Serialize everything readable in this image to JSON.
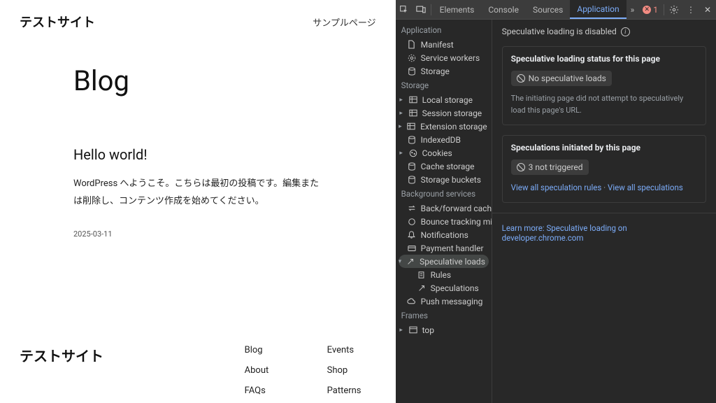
{
  "site": {
    "title": "テストサイト",
    "nav": "サンプルページ",
    "page_heading": "Blog",
    "post": {
      "title": "Hello world!",
      "body": "WordPress へようこそ。こちらは最初の投稿です。編集または削除し、コンテンツ作成を始めてください。",
      "date": "2025-03-11"
    },
    "footer_title": "テストサイト",
    "footer_cols": {
      "col1": {
        "a": "Blog",
        "b": "About",
        "c": "FAQs"
      },
      "col2": {
        "a": "Events",
        "b": "Shop",
        "c": "Patterns"
      }
    }
  },
  "devtools": {
    "tabs": {
      "elements": "Elements",
      "console": "Console",
      "sources": "Sources",
      "application": "Application",
      "more": "»"
    },
    "errors": "1",
    "side": {
      "application": "Application",
      "manifest": "Manifest",
      "service_workers": "Service workers",
      "storage_link": "Storage",
      "storage": "Storage",
      "local_storage": "Local storage",
      "session_storage": "Session storage",
      "extension_storage": "Extension storage",
      "indexeddb": "IndexedDB",
      "cookies": "Cookies",
      "cache_storage": "Cache storage",
      "storage_buckets": "Storage buckets",
      "bg_services": "Background services",
      "bfcache": "Back/forward cache",
      "bounce": "Bounce tracking mitigati...",
      "notifications": "Notifications",
      "payment": "Payment handler",
      "speculative": "Speculative loads",
      "rules": "Rules",
      "speculations": "Speculations",
      "push": "Push messaging",
      "frames": "Frames",
      "top": "top"
    },
    "main": {
      "disabled": "Speculative loading is disabled",
      "block1_title": "Speculative loading status for this page",
      "block1_pill": "No speculative loads",
      "block1_text": "The initiating page did not attempt to speculatively load this page's URL.",
      "block2_title": "Speculations initiated by this page",
      "block2_pill": "3 not triggered",
      "link1": "View all speculation rules",
      "link_sep": " · ",
      "link2": "View all speculations",
      "learn": "Learn more: Speculative loading on developer.chrome.com"
    }
  }
}
